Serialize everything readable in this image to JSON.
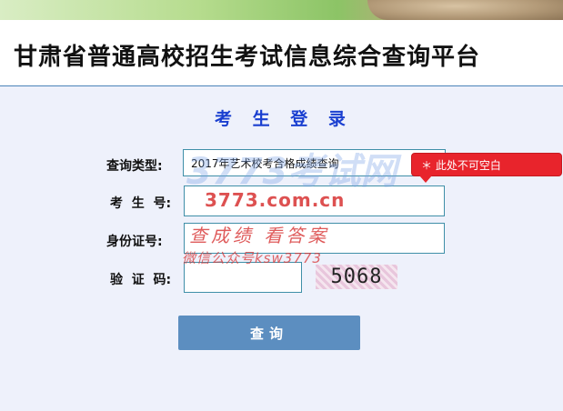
{
  "header": {
    "title": "甘肃省普通高校招生考试信息综合查询平台"
  },
  "form": {
    "title": "考 生 登 录",
    "query_type_label": "查询类型:",
    "query_type_value": "2017年艺术校考合格成绩查询",
    "exam_number_label": "考  生  号:",
    "id_number_label": "身份证号:",
    "captcha_label": "验  证  码:",
    "captcha_code": "5068",
    "submit_label": "查询"
  },
  "tooltip": {
    "text": "＊ 此处不可空白"
  },
  "watermark": {
    "line1": "3773考试网",
    "line2": "3773.com.cn",
    "line3": "查成绩 看答案",
    "line4": "微信公众号ksw3773"
  },
  "colors": {
    "title_blue": "#1a3fd0",
    "button_blue": "#5c8ec0",
    "error_red": "#e8242c",
    "background": "#eef1fb"
  }
}
